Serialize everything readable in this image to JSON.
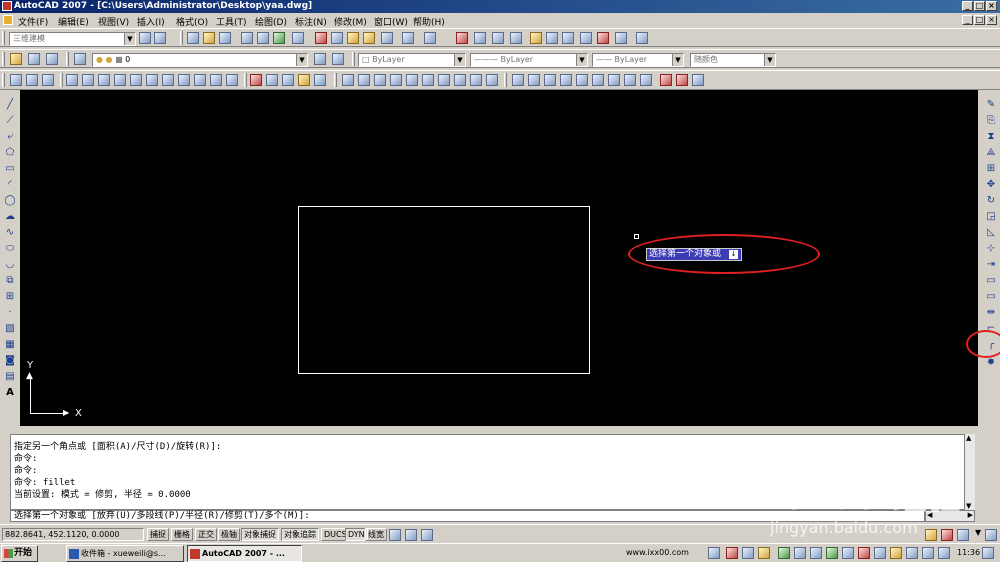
{
  "window": {
    "title": "AutoCAD 2007 - [C:\\Users\\Administrator\\Desktop\\yaa.dwg]",
    "min_glyph": "_",
    "max_glyph": "□",
    "close_glyph": "×"
  },
  "menu": [
    "文件(F)",
    "编辑(E)",
    "视图(V)",
    "插入(I)",
    "格式(O)",
    "工具(T)",
    "绘图(D)",
    "标注(N)",
    "修改(M)",
    "窗口(W)",
    "帮助(H)"
  ],
  "toolbar": {
    "workspace": "三维建模",
    "layer": "0",
    "color": "ByLayer",
    "linetype": "ByLayer",
    "lineweight": "ByLayer",
    "plotstyle": "随颜色"
  },
  "drawing": {
    "tooltip": "选择第一个对象或",
    "tooltip_key": "↓",
    "ucs_x": "X",
    "ucs_y": "Y"
  },
  "command_history": [
    "指定另一个角点或 [面积(A)/尺寸(D)/旋转(R)]:",
    "命令:",
    "命令:",
    "命令:  fillet",
    "当前设置: 模式 = 修剪, 半径 = 0.0000"
  ],
  "command_prompt": "选择第一个对象或 [放弃(U)/多段线(P)/半径(R)/修剪(T)/多个(M)]:",
  "status": {
    "coordinates": "882.8641,  452.1120, 0.0000",
    "buttons": [
      "捕捉",
      "栅格",
      "正交",
      "极轴",
      "对象捕捉",
      "对象追踪",
      "DUCS",
      "DYN",
      "线宽"
    ],
    "active_buttons": [
      "对象捕捉",
      "对象追踪",
      "DYN"
    ]
  },
  "taskbar": {
    "start": "开始",
    "tasks": [
      "收件箱 - xueweili@s...",
      "AutoCAD 2007 - ..."
    ],
    "url": "www.ixx00.com",
    "time": "11:36"
  },
  "watermark": {
    "main": "Bai du 经验",
    "sub": "jingyan.baidu.com"
  }
}
